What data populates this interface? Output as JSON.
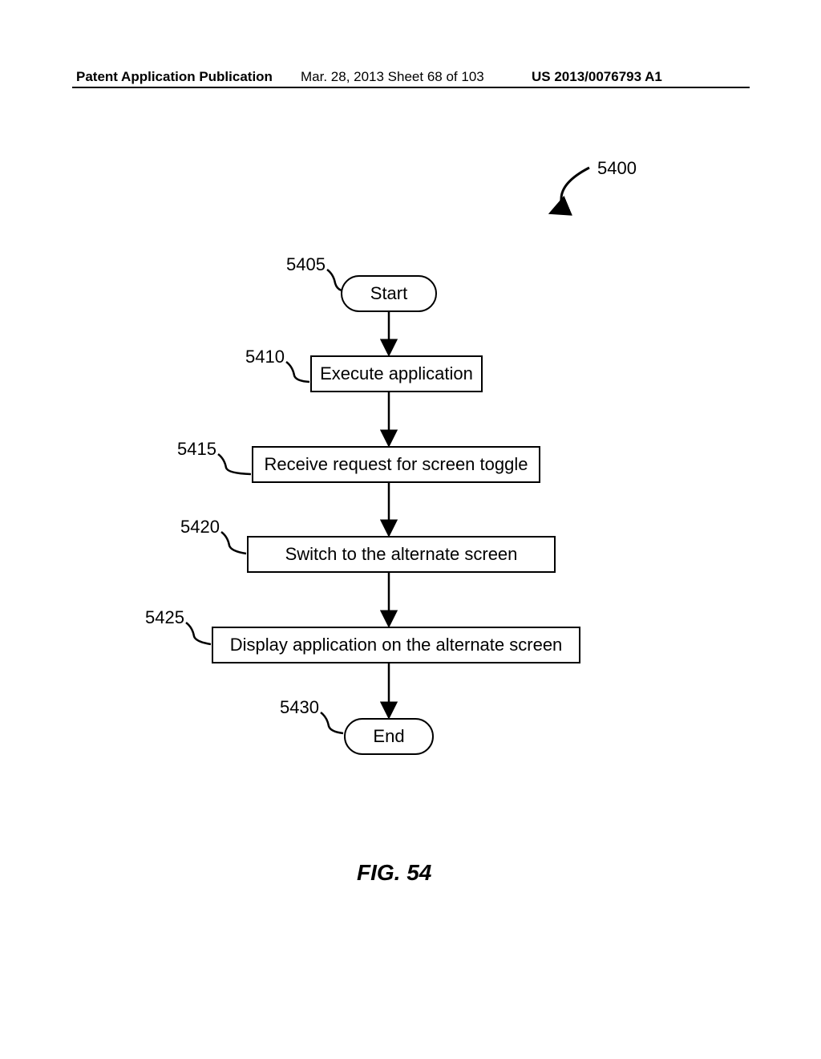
{
  "header": {
    "left": "Patent Application Publication",
    "mid": "Mar. 28, 2013  Sheet 68 of 103",
    "right": "US 2013/0076793 A1"
  },
  "figure_ref": "5400",
  "nodes": {
    "start": "Start",
    "exec": "Execute application",
    "receive": "Receive request for screen toggle",
    "switch": "Switch to the alternate screen",
    "display": "Display application on the alternate screen",
    "end": "End"
  },
  "refs": {
    "r5400": "5400",
    "r5405": "5405",
    "r5410": "5410",
    "r5415": "5415",
    "r5420": "5420",
    "r5425": "5425",
    "r5430": "5430"
  },
  "caption": "FIG. 54"
}
